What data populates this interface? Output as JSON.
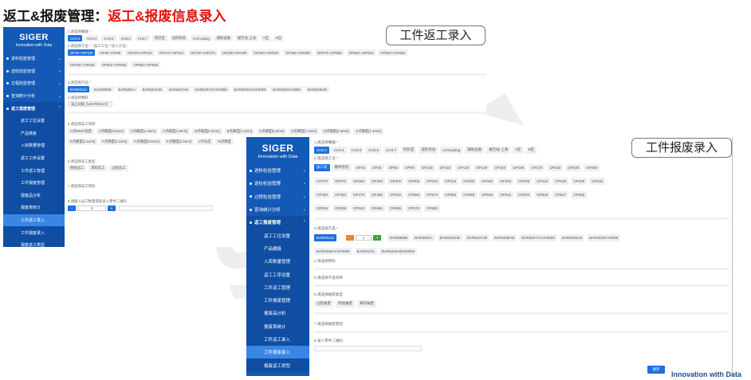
{
  "slide": {
    "title_prefix": "返工&报废管理：",
    "title_highlight": "返工&报废信息录入",
    "callout_rework": "工件返工录入",
    "callout_scrap": "工件报废录入",
    "footer_text": "Innovation with Data"
  },
  "brand": {
    "name": "SIGER",
    "tagline": "Innovation with Data"
  },
  "menu": {
    "items": [
      {
        "label": "进料检验管理"
      },
      {
        "label": "送检检验管理"
      },
      {
        "label": "过程检验管理"
      },
      {
        "label": "查询统计分析"
      },
      {
        "label": "返工报废管理"
      }
    ],
    "sub_items": [
      {
        "label": "返工工位设置"
      },
      {
        "label": "产品缴扱"
      },
      {
        "label": "入库数量管理"
      },
      {
        "label": "返工工序设置"
      },
      {
        "label": "工件返工管理"
      },
      {
        "label": "工件报废管理"
      },
      {
        "label": "报废品分析"
      },
      {
        "label": "报废率统计"
      },
      {
        "label": "工件返工录入"
      },
      {
        "label": "工件报废录入"
      },
      {
        "label": "报废返工类型"
      }
    ]
  },
  "rework_form": {
    "step1_label": "1.请选择機器 *",
    "machines": [
      "CH3.3",
      "CH3.4",
      "CH3.5",
      "CH3.6",
      "CH3.7",
      "检验室",
      "成形检验",
      "UVCoating",
      "铺助设备",
      "报告站-上海",
      "A区",
      "B区"
    ],
    "step2_label": "2.请选择工位 *（返工工位＝投入工位）",
    "stations_row1": [
      "OP30->OP100",
      "OP90->OP95",
      "OP100->OP110",
      "OP170->OP110",
      "OP230->OP270",
      "OP280->OP280",
      "OP340->OP520",
      "OP450->OP480",
      "OP570->OP560",
      "OP600->OP610",
      "OP620->OP625"
    ],
    "stations_row2": [
      "OP630->OP635",
      "OP640->OP660",
      "OP660->OP665"
    ],
    "step3_label": "3.请选择产品 *",
    "products": [
      "BAR0312A",
      "BAR0860B",
      "BAR5081A",
      "BAR5204AB",
      "BAR5207AB",
      "BAR5207ACVK9059",
      "BAR5206ACVK9059",
      "BAR0420CVK905",
      "BAR5205AB"
    ],
    "step4_label": "4.请选择物料",
    "material_tag": "请立刻删【LBAR0312A】",
    "step5_label": "5.请选择返工项目",
    "items_row1": [
      "A点55NV深度",
      "A点硬度[0.5mm]",
      "A点硬度[1.4mm]",
      "A点硬度[1.8mm]",
      "B点硬度[0.3mm]",
      "B点硬度[1.1mm]",
      "C点硬度[0.3mm]",
      "D点硬度[1.3mm]",
      "D点硬度[0.3mm]",
      "E点硬度[1.3mm]"
    ],
    "items_row2": [
      "E点硬度[1.1mm]",
      "F点硬度[1.1mm]",
      "H点硬度[0.6mm]",
      "K点硬度[1.5mm]",
      "L环长度",
      "M点硬度"
    ],
    "step6_label": "6.请选择返工类型",
    "types": [
      "原始返工",
      "来料返工",
      "过程返工"
    ],
    "step7_label": "7.请选择返工原因",
    "step8_label": "8.请输入返工数量或者录入零件二维码",
    "qty_value": "0",
    "minus_label": "-",
    "plus_label": "+"
  },
  "scrap_form": {
    "step1_label": "1.请选择機器 *",
    "machines": [
      "CH3.3",
      "CH3.4",
      "CH3.5",
      "CH3.6",
      "CH3.7",
      "检验室",
      "成形检验",
      "UVCoating",
      "铺助设备",
      "报告站-上海",
      "A区",
      "B区"
    ],
    "step2_label": "2.请选择工位 *",
    "stations_row1": [
      "加工前",
      "最终检验",
      "OP10",
      "OP30",
      "OP50",
      "OP90",
      "OP100",
      "OP110",
      "OP120",
      "OP130",
      "OP150",
      "OP160",
      "OP170",
      "OP220",
      "OP230",
      "OP250"
    ],
    "stations_row2": [
      "OP270",
      "OP275",
      "OP280",
      "OP290",
      "OP300",
      "OP305",
      "OP310",
      "OP315",
      "OP330",
      "OP340",
      "OP400",
      "OP405",
      "OP410",
      "OP420",
      "OP430",
      "OP440"
    ],
    "stations_row3": [
      "OP450",
      "OP460",
      "OP470",
      "OP480",
      "OP520",
      "OP560",
      "OP570",
      "OP580",
      "OP585",
      "OP600",
      "OP610",
      "OP620",
      "OP625",
      "OP627",
      "OP630"
    ],
    "stations_row4": [
      "OP635",
      "OP639",
      "OP640",
      "OP660",
      "OP665",
      "OP670",
      "OP680"
    ],
    "step3_label": "3.请选择产品 *",
    "products_row1": [
      "BAR0312A",
      "BAR0860B",
      "BAR5081A",
      "BAR5204AB",
      "BAR5207AB",
      "BAR5206AB",
      "BAR5207ACVK9059",
      "BAR5205AB",
      "BAR0420CVK905"
    ],
    "products_row2": [
      "BAR5206ACVK9059",
      "BAR0313C",
      "BAR5204ABVK9052"
    ],
    "qty_value": "1",
    "minus_label": "-",
    "plus_label": "+",
    "step4_label": "4.请选择物料",
    "step5_label": "5.请选择不良项目",
    "step6_label": "6.请选择报废类型",
    "types": [
      "过程报废",
      "原始报废",
      "来料报废"
    ],
    "step7_label": "7.请选择报废原因",
    "step8_label": "8.录入零件二维码",
    "submit_label": "保存"
  }
}
